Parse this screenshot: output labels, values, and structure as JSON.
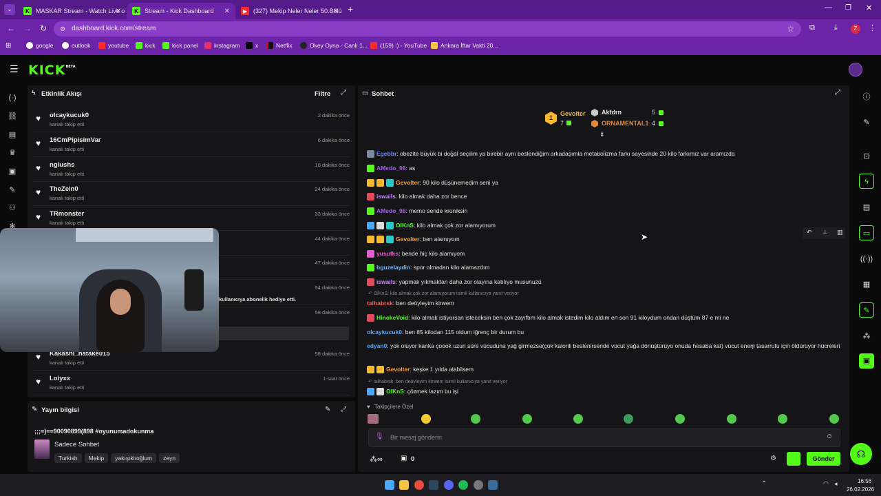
{
  "browser": {
    "tabs": [
      {
        "title": "MASKAR Stream - Watch Live o",
        "favicon": "kick-icon"
      },
      {
        "title": "Stream - Kick Dashboard",
        "favicon": "kick-icon"
      },
      {
        "title": "(327) Mekip Neler Neler 50.Bölü",
        "favicon": "youtube-icon"
      }
    ],
    "url": "dashboard.kick.com/stream",
    "profile_initial": "Z",
    "bookmarks": [
      "google",
      "outlook",
      "youtube",
      "kick",
      "kick panel",
      "instagram",
      "x",
      "Netflix",
      "Okey Oyna - Canlı 1...",
      "(159) :) - YouTube",
      "Ankara İftar Vakti 20..."
    ]
  },
  "app": {
    "logo": "KICK",
    "logo_badge": "BETA"
  },
  "activity": {
    "title": "Etkinlik Akışı",
    "filter_label": "Filtre",
    "events": [
      {
        "name": "olcaykucuk0",
        "action": "kanalı takip etti",
        "time": "2 dakika önce"
      },
      {
        "name": "16CmPipisimVar",
        "action": "kanalı takip etti",
        "time": "6 dakika önce"
      },
      {
        "name": "nglushs",
        "action": "kanalı takip etti",
        "time": "16 dakika önce"
      },
      {
        "name": "TheZein0",
        "action": "kanalı takip etti",
        "time": "24 dakika önce"
      },
      {
        "name": "TRmonster",
        "action": "kanalı takip etti",
        "time": "33 dakika önce"
      },
      {
        "name": "",
        "action": "",
        "time": "44 dakika önce"
      },
      {
        "name": "",
        "action": "",
        "time": "47 dakika önce"
      },
      {
        "name": "",
        "action": "kullanıcıya abonelik hediye etti.",
        "time": "54 dakika önce"
      },
      {
        "name": "",
        "action": "",
        "time": "58 dakika önce"
      },
      {
        "name": "Kakashi_hatake015",
        "action": "kanalı takip etti",
        "time": "58 dakika önce"
      },
      {
        "name": "Loiyxx",
        "action": "kanalı takip etti",
        "time": "1 saat önce"
      }
    ]
  },
  "stream_info": {
    "title": "Yayın bilgisi",
    "stream_title": ";;;=)==90090899(898 #oyunumadokunma",
    "category": "Sadece Sohbet",
    "tags": [
      "Turkish",
      "Mekip",
      "yakışıklıoğlum",
      "zeyn"
    ]
  },
  "chat": {
    "title": "Sohbet",
    "leaderboard": [
      {
        "rank": "1",
        "name": "Gevolter",
        "count": "7"
      },
      {
        "rank": "2",
        "name": "Akfdrn",
        "count": "5"
      },
      {
        "rank": "3",
        "name": "ORNAMENTAL1",
        "count": "4"
      }
    ],
    "messages": [
      {
        "user": "Egebbr",
        "color": "#6b8cff",
        "text": ": obezite büyük bi doğal seçilim ya birebir aynı beslendiğim arkadaşımla metabolizma farkı sayesinde 20 kilo farkımız var aramızda"
      },
      {
        "user": "AMedo_96",
        "color": "#a55cf5",
        "text": ": as"
      },
      {
        "user": "Gevolter",
        "color": "#ff9e2c",
        "text": ": 90 kilo düşünemedim seni ya"
      },
      {
        "user": "iswails",
        "color": "#c88bff",
        "text": ": kilo almak daha zor bence"
      },
      {
        "user": "AMedo_96",
        "color": "#a55cf5",
        "text": ": memo sende kroniksin"
      },
      {
        "user": "OlKnS",
        "color": "#53fc18",
        "text": ": kilo almak çok zor alamıyorum"
      },
      {
        "user": "Gevolter",
        "color": "#ff9e2c",
        "text": ": ben alamıyom"
      },
      {
        "user": "yusufks",
        "color": "#e65bd0",
        "text": ": bende hiç kilo alamıyom"
      },
      {
        "user": "bguzelaydin",
        "color": "#6fb8ff",
        "text": ": spor olmadan kilo alamazdım"
      },
      {
        "user": "iswails",
        "color": "#c88bff",
        "text": ": yapmak yıkmaktan daha zor olayına katılıyo musunuzü"
      },
      {
        "user": "talhabrsk",
        "color": "#ff5a5a",
        "text": ": ben deöyleyim kirwem",
        "reply": "OlKnS: kilo almak çok zor alamıyorum isimli kullanıcıya yanıt veriyor"
      },
      {
        "user": "HinokeVoid",
        "color": "#53fc18",
        "text": ": kilo almak istiyorsan isteceksin ben çok zayıftım kilo almak istedim kilo aldım en son 91 kiloydum ondan düştüm 87 e mi ne"
      },
      {
        "user": "olcaykucuk0",
        "color": "#5aa9ff",
        "text": ": ben 85 kilodan 115 oldum iğrenç bir durum bu"
      },
      {
        "user": "edyan0",
        "color": "#5aa9ff",
        "text": ": yok oluyor kanka çoook uzun süre vücuduna yağ girmezse(çok kalorili beslenirsende vücut yağa dönüştürüyo onuda hesaba kat) vücut enerji tasarrufu için öldürüyor hücreleri"
      },
      {
        "user": "Gevolter",
        "color": "#ff9e2c",
        "text": ": keşke 1 yılda alabilsem"
      },
      {
        "user": "OlKnS",
        "color": "#53fc18",
        "text": ": çözmek lazım bu işi",
        "reply": "talhabrsk: ben deöyleyim kirwem isimli kullanıcıya yanıt veriyor"
      }
    ],
    "followers_only_label": "Takipçilere Özel",
    "input_placeholder": "Bir mesaj gönderin",
    "points": "0",
    "send_label": "Gönder"
  },
  "taskbar": {
    "time": "16:56",
    "date": "26.02.2026"
  },
  "colors": {
    "accent": "#53fc18",
    "browser_purple": "#6b24a8",
    "panel": "#151517"
  }
}
